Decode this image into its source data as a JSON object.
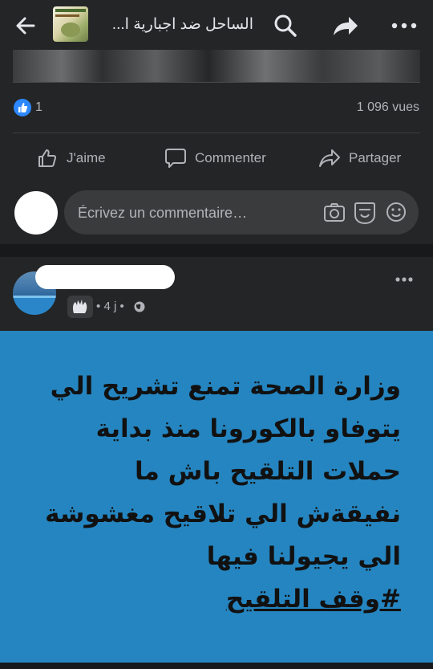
{
  "header": {
    "group_title": "الساحل ضد اجبارية ا...",
    "icons": [
      "back-arrow-icon",
      "group-thumbnail",
      "search-icon",
      "share-arrow-icon",
      "more-dots-icon"
    ]
  },
  "previous_post": {
    "like_count": "1",
    "views": "1 096 vues",
    "actions": {
      "like": "J'aime",
      "comment": "Commenter",
      "share": "Partager"
    },
    "composer_placeholder": "Écrivez un commentaire…"
  },
  "post": {
    "time": "4 j",
    "separator": "•",
    "text_lines": [
      "وزارة الصحة تمنع تشريح الي",
      "يتوفاو بالكورونا منذ بداية",
      "حملات التلقيح باش ما",
      "نفيقةش الي تلاقيح مغشوشة",
      "الي يجيولنا فيها"
    ],
    "hashtag": "#وقف التلقيح",
    "image_background": "#2585c0"
  },
  "colors": {
    "background": "#242526",
    "accent": "#2d88ff",
    "secondary_text": "#b0b3b8"
  }
}
